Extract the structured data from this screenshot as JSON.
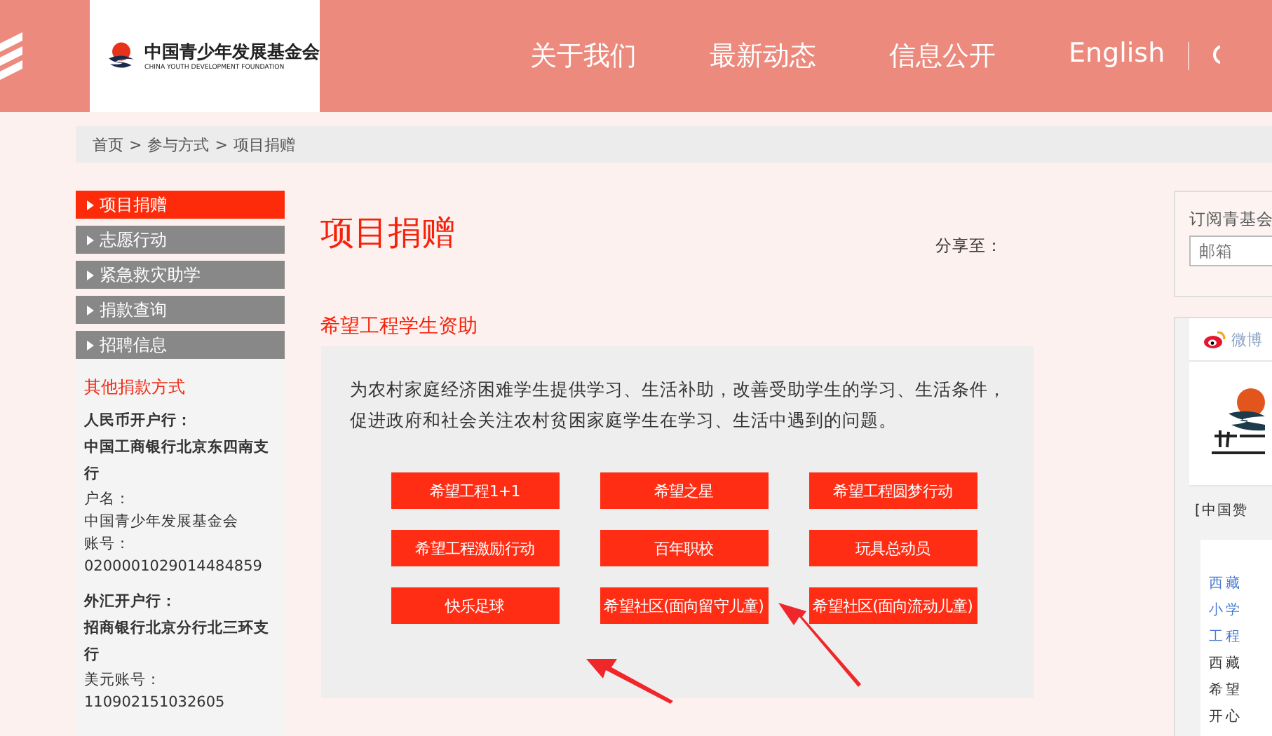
{
  "header": {
    "logo": {
      "name": "中国青少年发展基金会",
      "subtitle": "CHINA YOUTH DEVELOPMENT FOUNDATION"
    },
    "nav": [
      {
        "label": "关于我们"
      },
      {
        "label": "最新动态"
      },
      {
        "label": "信息公开"
      },
      {
        "label": "English"
      }
    ]
  },
  "breadcrumb": [
    "首页",
    ">",
    "参与方式",
    ">",
    "项目捐赠"
  ],
  "sidebar": {
    "items": [
      {
        "label": "项目捐赠",
        "selected": true
      },
      {
        "label": "志愿行动",
        "selected": false
      },
      {
        "label": "紧急救灾助学",
        "selected": false
      },
      {
        "label": "捐款查询",
        "selected": false
      },
      {
        "label": "招聘信息",
        "selected": false
      }
    ],
    "other": {
      "title": "其他捐款方式",
      "lines": [
        {
          "kind": "bold",
          "text": "人民币开户行："
        },
        {
          "kind": "bold",
          "text": "中国工商银行北京东四南支行"
        },
        {
          "kind": "plain",
          "text": "户名："
        },
        {
          "kind": "plain",
          "text": "中国青少年发展基金会"
        },
        {
          "kind": "plain",
          "text": "账号："
        },
        {
          "kind": "plain",
          "text": "0200001029014484859"
        },
        {
          "kind": "gap",
          "text": "外汇开户行："
        },
        {
          "kind": "bold",
          "text": "招商银行北京分行北三环支行"
        },
        {
          "kind": "plain",
          "text": "美元账号："
        },
        {
          "kind": "plain",
          "text": "110902151032605"
        }
      ]
    }
  },
  "main": {
    "title": "项目捐赠",
    "share": "分享至：",
    "section": "希望工程学生资助",
    "description": "为农村家庭经济困难学生提供学习、生活补助，改善受助学生的学习、生活条件，促进政府和社会关注农村贫困家庭学生在学习、生活中遇到的问题。",
    "buttons": [
      {
        "label": "希望工程1+1"
      },
      {
        "label": "希望之星"
      },
      {
        "label": "希望工程圆梦行动"
      },
      {
        "label": "希望工程激励行动"
      },
      {
        "label": "百年职校"
      },
      {
        "label": "玩具总动员"
      },
      {
        "label": "快乐足球"
      },
      {
        "label": "希望社区(面向留守儿童)"
      },
      {
        "label": "希望社区(面向流动儿童)"
      }
    ]
  },
  "right": {
    "subscribe": {
      "title": "订阅青基会",
      "placeholder": "邮箱"
    },
    "weibo": {
      "tab": "微博",
      "quote": "[中国赞",
      "lines": [
        {
          "text": "西藏",
          "link": true
        },
        {
          "text": "小学",
          "link": true
        },
        {
          "text": "工程",
          "link": true
        },
        {
          "text": "西藏",
          "link": false
        },
        {
          "text": "希望",
          "link": false
        },
        {
          "text": "开心",
          "link": false
        }
      ]
    }
  }
}
